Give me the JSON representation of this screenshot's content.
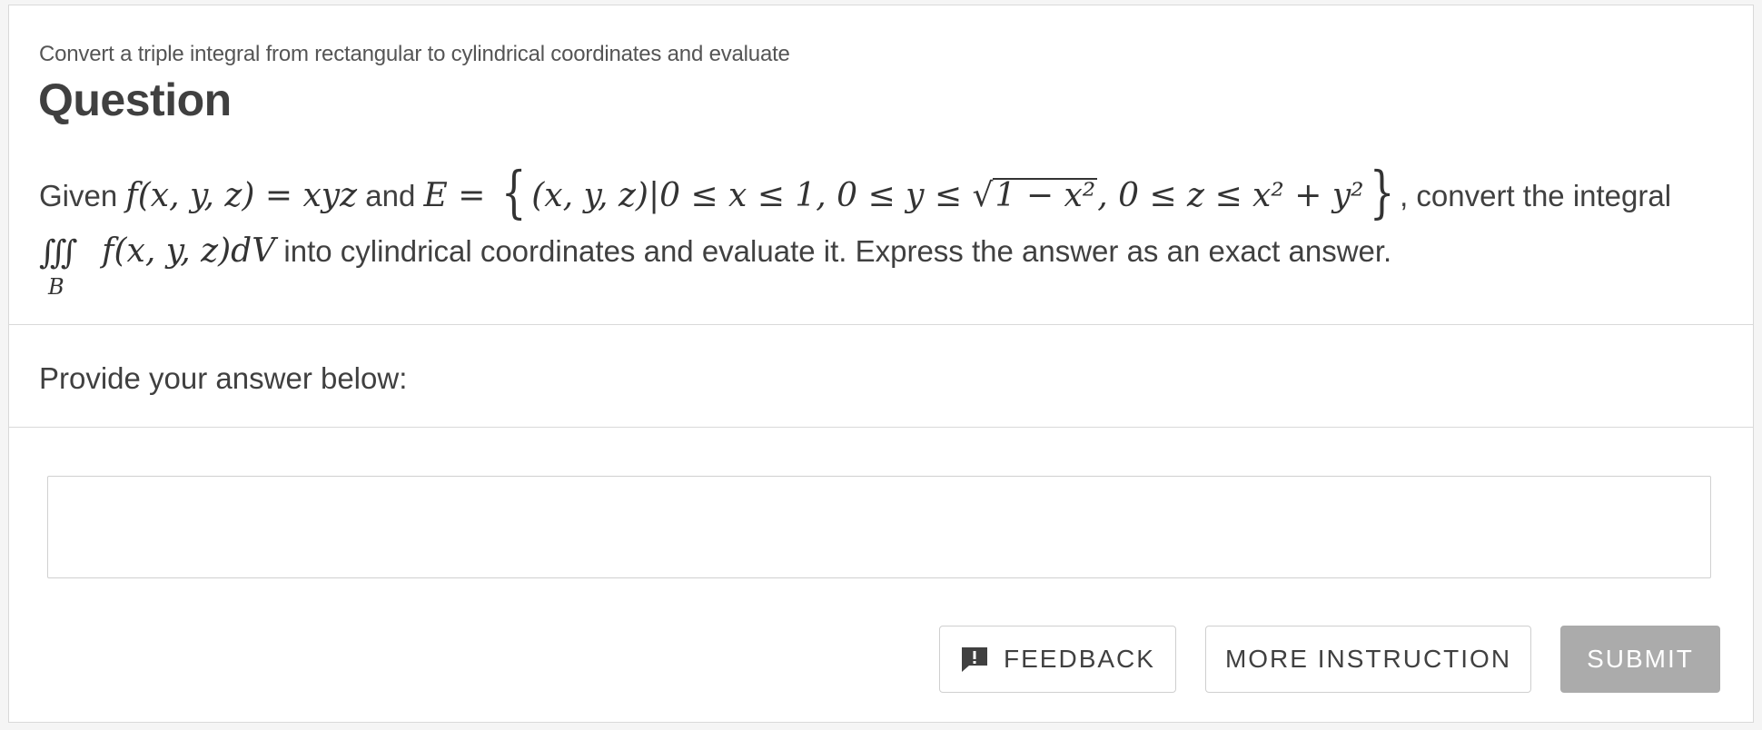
{
  "header": {
    "subtitle": "Convert a triple integral from rectangular to cylindrical coordinates and evaluate",
    "title": "Question"
  },
  "question": {
    "line1_given": "Given",
    "f_def": "f(x, y, z) = xyz",
    "and": "and",
    "E_lhs": "E = ",
    "set_open": "{",
    "set_body_pre": "(x, y, z)|0 ≤ x ≤ 1, 0 ≤ y ≤ ",
    "sqrt_content": "1 − x²",
    "set_body_post": ", 0 ≤ z ≤ x² + y²",
    "set_close": "}",
    "line1_tail": ", convert the integral",
    "integral_symbol": "∭",
    "integral_region": "B",
    "integrand": "f(x, y, z)dV",
    "line2_tail": "into cylindrical coordinates and evaluate it. Express the answer as an exact answer."
  },
  "answer": {
    "prompt": "Provide your answer below:",
    "value": ""
  },
  "buttons": {
    "feedback": "FEEDBACK",
    "more_instruction": "MORE INSTRUCTION",
    "submit": "SUBMIT"
  },
  "icons": {
    "feedback": "feedback-icon"
  },
  "colors": {
    "submit_disabled_bg": "#ababab",
    "text": "#404040",
    "border": "#d9d9d9"
  }
}
